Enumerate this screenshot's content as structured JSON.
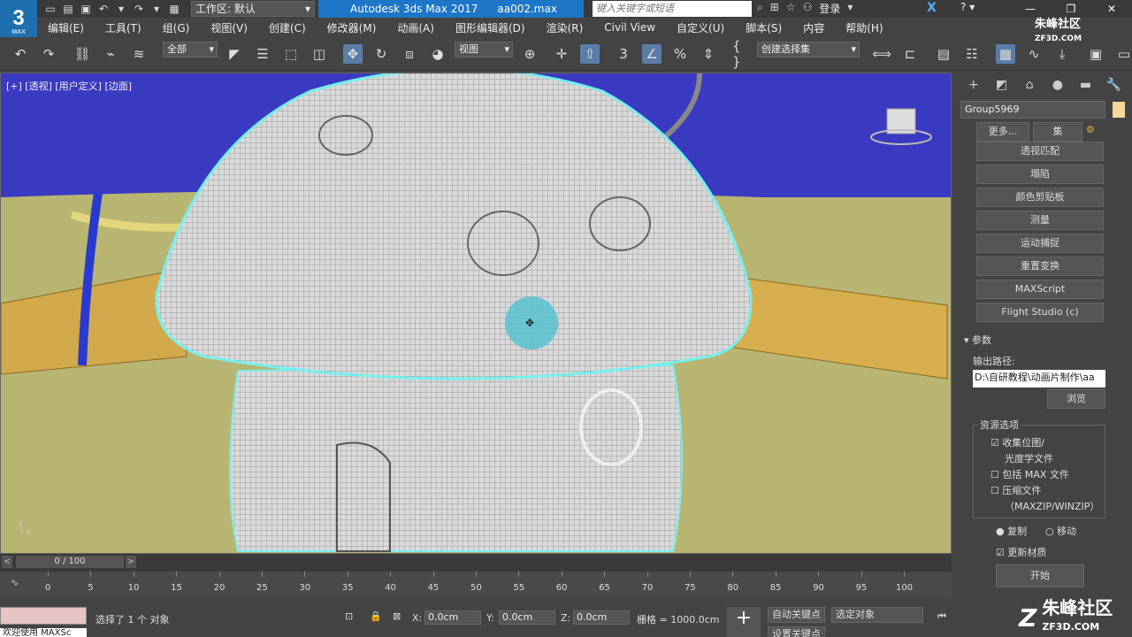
{
  "title": {
    "logo": "3",
    "logo_sub": "MAX",
    "workspace": "工作区: 默认",
    "app": "Autodesk 3ds Max 2017",
    "file": "aa002.max",
    "search_placeholder": "键入关键字或短语",
    "login": "登录",
    "help": "?"
  },
  "menu": [
    "编辑(E)",
    "工具(T)",
    "组(G)",
    "视图(V)",
    "创建(C)",
    "修改器(M)",
    "动画(A)",
    "图形编辑器(D)",
    "渲染(R)",
    "Civil View",
    "自定义(U)",
    "脚本(S)",
    "内容",
    "帮助(H)"
  ],
  "toolbar": {
    "filter": "全部",
    "view": "视图",
    "selection_set": "创建选择集"
  },
  "viewport": {
    "label": "[+] [透视] [用户定义] [边面]"
  },
  "command_panel": {
    "object_name": "Group5969",
    "top_buttons": [
      "更多...",
      "集"
    ],
    "buttons": [
      "透视匹配",
      "塌陷",
      "颜色剪贴板",
      "测量",
      "运动捕捉",
      "重置变换",
      "MAXScript",
      "Flight Studio (c)"
    ],
    "rollout": "参数",
    "output_label": "输出路径:",
    "output_path": "D:\\自研教程\\动画片制作\\aa",
    "browse": "浏览",
    "res_group": "资源选项",
    "opt1": "收集位图/",
    "opt1b": "光度学文件",
    "opt2": "包括 MAX 文件",
    "opt3": "压缩文件",
    "opt3b": "（MAXZIP/WINZIP）",
    "radio1": "复制",
    "radio2": "移动",
    "update": "更新材质",
    "start": "开始"
  },
  "timeline": {
    "frame": "0 / 100",
    "ticks": [
      "0",
      "5",
      "10",
      "15",
      "20",
      "25",
      "30",
      "35",
      "40",
      "45",
      "50",
      "55",
      "60",
      "65",
      "70",
      "75",
      "80",
      "85",
      "90",
      "95",
      "100"
    ]
  },
  "status": {
    "maxscript": "欢迎使用 MAXSc",
    "selected": "选择了 1 个 对象",
    "x": "0.0cm",
    "y": "0.0cm",
    "z": "0.0cm",
    "grid": "栅格 = 1000.0cm",
    "auto_key": "自动关键点",
    "set_key": "设置关键点",
    "sel_obj": "选定对象",
    "x_label": "X:",
    "y_label": "Y:",
    "z_label": "Z:"
  },
  "watermark": {
    "top": "朱峰社区",
    "top_sub": "ZF3D.COM",
    "bottom": "朱峰社区",
    "bottom_sub": "ZF3D.COM"
  }
}
